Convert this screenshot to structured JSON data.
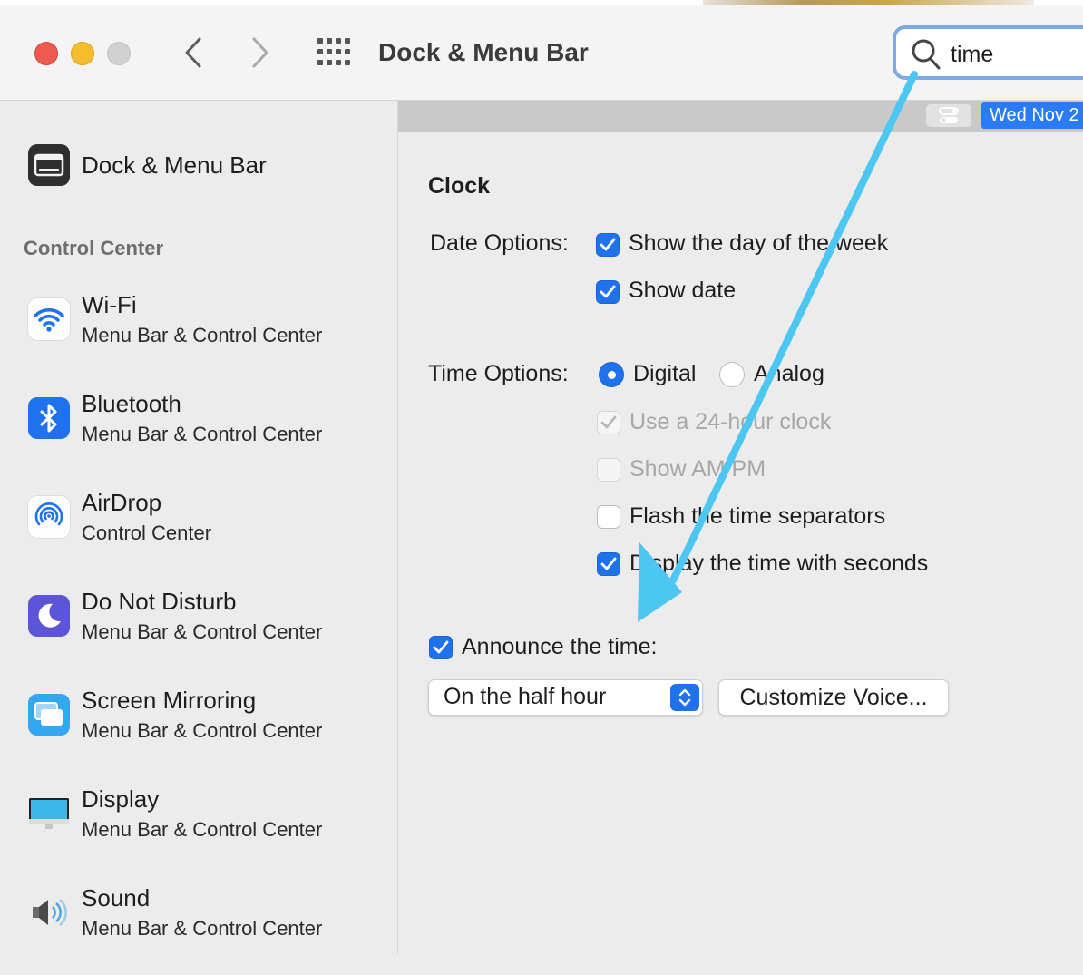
{
  "window": {
    "title": "Dock & Menu Bar",
    "search_value": "time"
  },
  "sidebar": {
    "top_item": {
      "title": "Dock & Menu Bar",
      "icon": "dock-menubar-icon"
    },
    "section_label": "Control Center",
    "items": [
      {
        "title": "Wi-Fi",
        "subtitle": "Menu Bar & Control Center",
        "icon": "wifi-icon"
      },
      {
        "title": "Bluetooth",
        "subtitle": "Menu Bar & Control Center",
        "icon": "bluetooth-icon"
      },
      {
        "title": "AirDrop",
        "subtitle": "Control Center",
        "icon": "airdrop-icon"
      },
      {
        "title": "Do Not Disturb",
        "subtitle": "Menu Bar & Control Center",
        "icon": "moon-icon"
      },
      {
        "title": "Screen Mirroring",
        "subtitle": "Menu Bar & Control Center",
        "icon": "screen-mirroring-icon"
      },
      {
        "title": "Display",
        "subtitle": "Menu Bar & Control Center",
        "icon": "display-icon"
      },
      {
        "title": "Sound",
        "subtitle": "Menu Bar & Control Center",
        "icon": "speaker-icon"
      }
    ]
  },
  "preview_bar": {
    "date_text": "Wed Nov 2"
  },
  "clock": {
    "heading": "Clock",
    "date_options_label": "Date Options:",
    "show_day_of_week": {
      "label": "Show the day of the week",
      "checked": true
    },
    "show_date": {
      "label": "Show date",
      "checked": true
    },
    "time_options_label": "Time Options:",
    "digital": {
      "label": "Digital",
      "selected": true
    },
    "analog": {
      "label": "Analog",
      "selected": false
    },
    "use_24_hour": {
      "label": "Use a 24-hour clock",
      "checked": true,
      "enabled": false
    },
    "show_ampm": {
      "label": "Show AM/PM",
      "checked": false,
      "enabled": false
    },
    "flash_separators": {
      "label": "Flash the time separators",
      "checked": false
    },
    "display_seconds": {
      "label": "Display the time with seconds",
      "checked": true
    },
    "announce_time": {
      "label": "Announce the time:",
      "checked": true
    },
    "announce_interval": "On the half hour",
    "customize_voice_label": "Customize Voice..."
  },
  "colors": {
    "accent": "#1f72ec",
    "annotation_arrow": "#4cc7f2"
  }
}
